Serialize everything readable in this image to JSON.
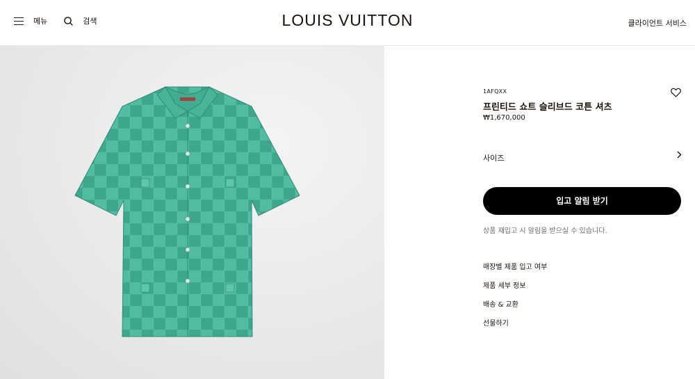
{
  "header": {
    "menu_label": "메뉴",
    "search_label": "검색",
    "logo": "LOUIS VUITTON",
    "client_service": "클라이언트 서비스"
  },
  "product": {
    "sku": "1AFQXX",
    "name": "프린티드 쇼트 슬리브드 코튼 셔츠",
    "price": "₩1,670,000",
    "size_label": "사이즈",
    "cta_label": "입고 알림 받기",
    "note": "상품 재입고 시 알림을 받으실 수 있습니다.",
    "links": [
      "매장별 제품 입고 여부",
      "제품 세부 정보",
      "배송 & 교환",
      "선물하기"
    ],
    "image_colors": {
      "shirt_light": "#4fb9a0",
      "shirt_dark": "#3aa38b",
      "collar_label": "#a0463a"
    }
  },
  "icons": {
    "menu": "hamburger-icon",
    "search": "search-icon",
    "wishlist": "heart-icon",
    "size_arrow": "chevron-right-icon"
  }
}
